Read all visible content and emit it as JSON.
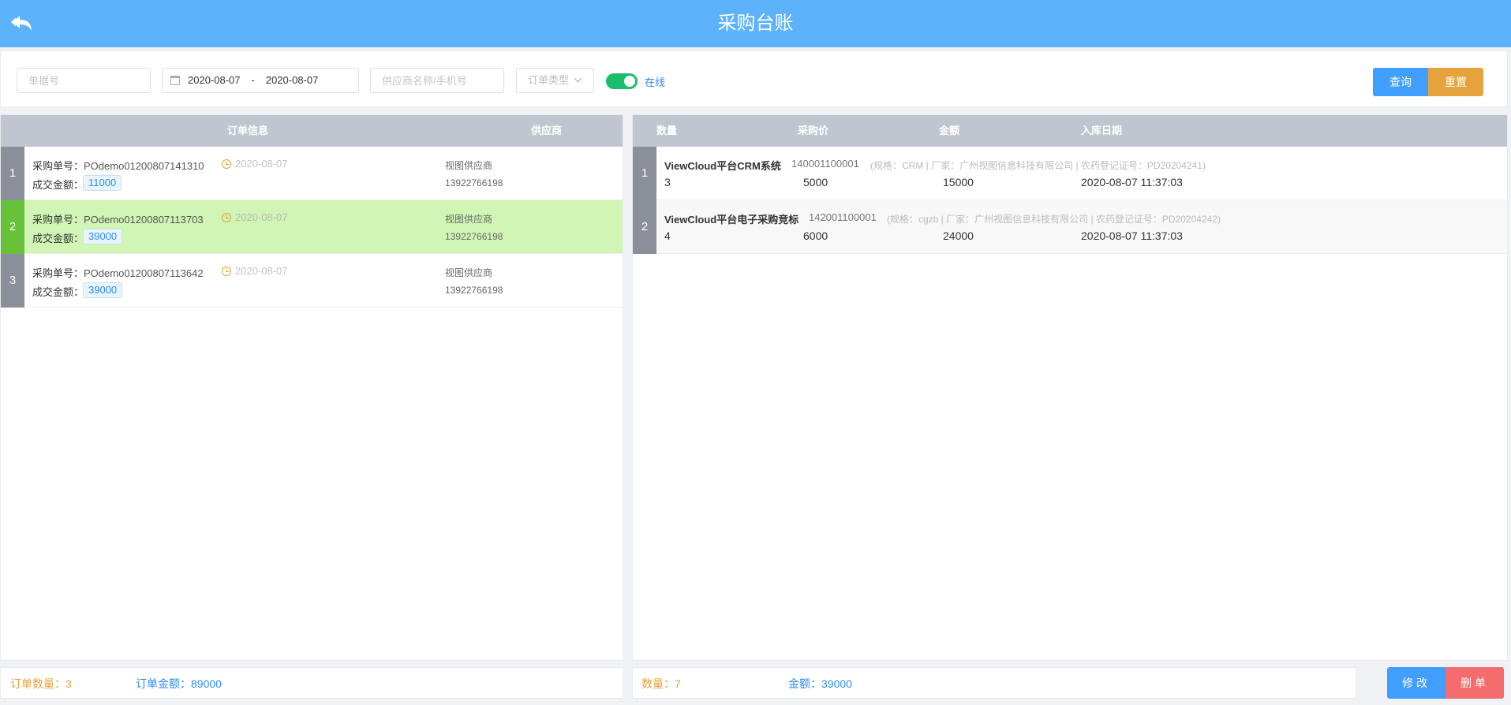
{
  "header": {
    "title": "采购台账",
    "back_icon": "back-arrow-icon"
  },
  "filters": {
    "order_no_placeholder": "单据号",
    "date_start": "2020-08-07",
    "date_sep": "-",
    "date_end": "2020-08-07",
    "supplier_placeholder": "供应商名称/手机号",
    "order_type_placeholder": "订单类型",
    "online_label": "在线",
    "online_enabled": true,
    "query_label": "查询",
    "reset_label": "重置"
  },
  "orders": {
    "headers": {
      "info": "订单信息",
      "supplier": "供应商"
    },
    "po_label": "采购单号：",
    "amount_label": "成交金额：",
    "rows": [
      {
        "index": "1",
        "po_no": "POdemo01200807141310",
        "date": "2020-08-07",
        "amount": "11000",
        "supplier": "视图供应商",
        "phone": "13922766198"
      },
      {
        "index": "2",
        "po_no": "POdemo01200807113703",
        "date": "2020-08-07",
        "amount": "39000",
        "supplier": "视图供应商",
        "phone": "13922766198",
        "selected": true
      },
      {
        "index": "3",
        "po_no": "POdemo01200807113642",
        "date": "2020-08-07",
        "amount": "39000",
        "supplier": "视图供应商",
        "phone": "13922766198"
      }
    ]
  },
  "details": {
    "headers": {
      "qty": "数量",
      "price": "采购价",
      "amount": "金额",
      "date": "入库日期"
    },
    "rows": [
      {
        "index": "1",
        "name": "ViewCloud平台CRM系统",
        "code": "140001100001",
        "spec": "(规格：CRM | 厂家：广州视图信息科技有限公司 | 农药登记证号：PD20204241)",
        "qty": "3",
        "price": "5000",
        "amount": "15000",
        "date": "2020-08-07 11:37:03"
      },
      {
        "index": "2",
        "name": "ViewCloud平台电子采购竞标",
        "code": "142001100001",
        "spec": "(规格：cgzb | 厂家：广州视图信息科技有限公司 | 农药登记证号：PD20204242)",
        "qty": "4",
        "price": "6000",
        "amount": "24000",
        "date": "2020-08-07 11:37:03"
      }
    ]
  },
  "footer": {
    "order_count": "订单数量：3",
    "order_amount": "订单金额：89000",
    "qty_total": "数量：7",
    "amount_total": "金额：39000",
    "edit_label": "修改",
    "delete_label": "删单"
  },
  "colors": {
    "header_bg": "#5cb3fb",
    "selected_row": "#d1f5b5",
    "query": "#409eff",
    "reset": "#e6a23c",
    "delete": "#f56c6c",
    "toggle_on": "#19be6b"
  }
}
